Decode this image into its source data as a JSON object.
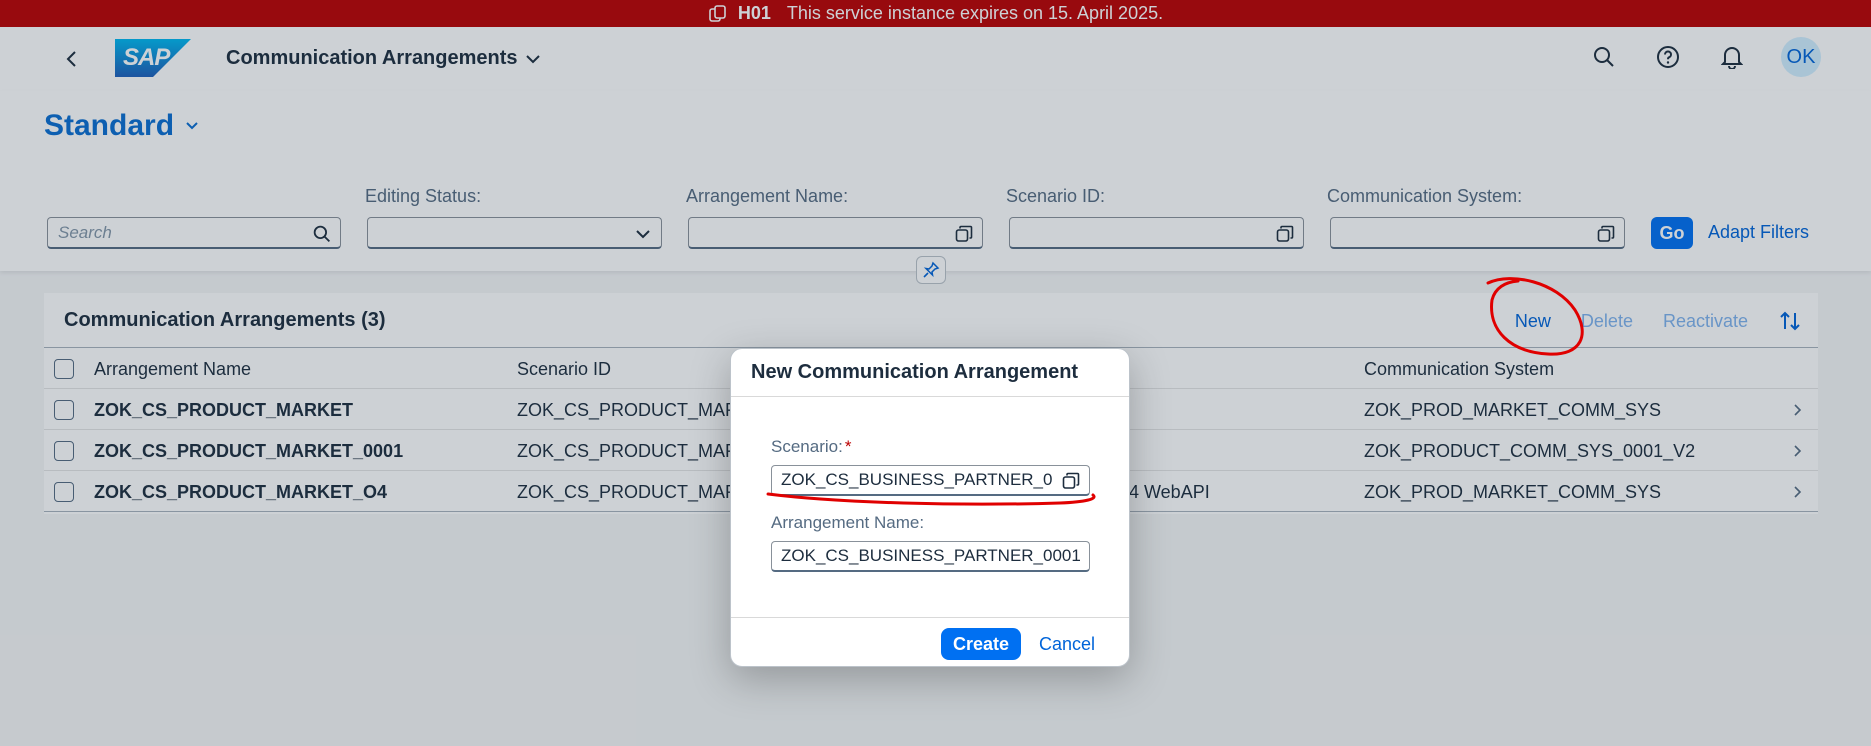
{
  "banner": {
    "system_id": "H01",
    "message": "This service instance expires on 15. April 2025.",
    "color": "#bb0000"
  },
  "shell": {
    "logo_text": "SAP",
    "app_title": "Communication Arrangements",
    "avatar_initials": "OK",
    "icons": [
      "search-icon",
      "help-icon",
      "bell-icon"
    ]
  },
  "header": {
    "variant_name": "Standard",
    "search_placeholder": "Search",
    "filters": {
      "editing_status_label": "Editing Status:",
      "arrangement_name_label": "Arrangement Name:",
      "scenario_id_label": "Scenario ID:",
      "communication_system_label": "Communication System:"
    },
    "go_label": "Go",
    "adapt_filters_label": "Adapt Filters"
  },
  "table": {
    "title": "Communication Arrangements (3)",
    "actions": {
      "new": "New",
      "delete": "Delete",
      "reactivate": "Reactivate"
    },
    "columns": {
      "arrangement_name": "Arrangement Name",
      "scenario_id": "Scenario ID",
      "communication_system": "Communication System"
    },
    "rows": [
      {
        "arrangement_name": "ZOK_CS_PRODUCT_MARKET",
        "scenario_id": "ZOK_CS_PRODUCT_MARK",
        "mid": "",
        "communication_system": "ZOK_PROD_MARKET_COMM_SYS"
      },
      {
        "arrangement_name": "ZOK_CS_PRODUCT_MARKET_0001",
        "scenario_id": "ZOK_CS_PRODUCT_MARK",
        "mid": "",
        "communication_system": "ZOK_PRODUCT_COMM_SYS_0001_V2"
      },
      {
        "arrangement_name": "ZOK_CS_PRODUCT_MARKET_O4",
        "scenario_id": "ZOK_CS_PRODUCT_MARK",
        "mid": "4 WebAPI",
        "communication_system": "ZOK_PROD_MARKET_COMM_SYS"
      }
    ]
  },
  "dialog": {
    "title": "New Communication Arrangement",
    "scenario_label": "Scenario:",
    "required_marker": "*",
    "scenario_value": "ZOK_CS_BUSINESS_PARTNER_0",
    "arrangement_name_label": "Arrangement Name:",
    "arrangement_name_value": "ZOK_CS_BUSINESS_PARTNER_0001",
    "create_label": "Create",
    "cancel_label": "Cancel"
  },
  "colors": {
    "accent": "#0070f2",
    "link": "#0064d9",
    "annotation": "#e00000"
  }
}
